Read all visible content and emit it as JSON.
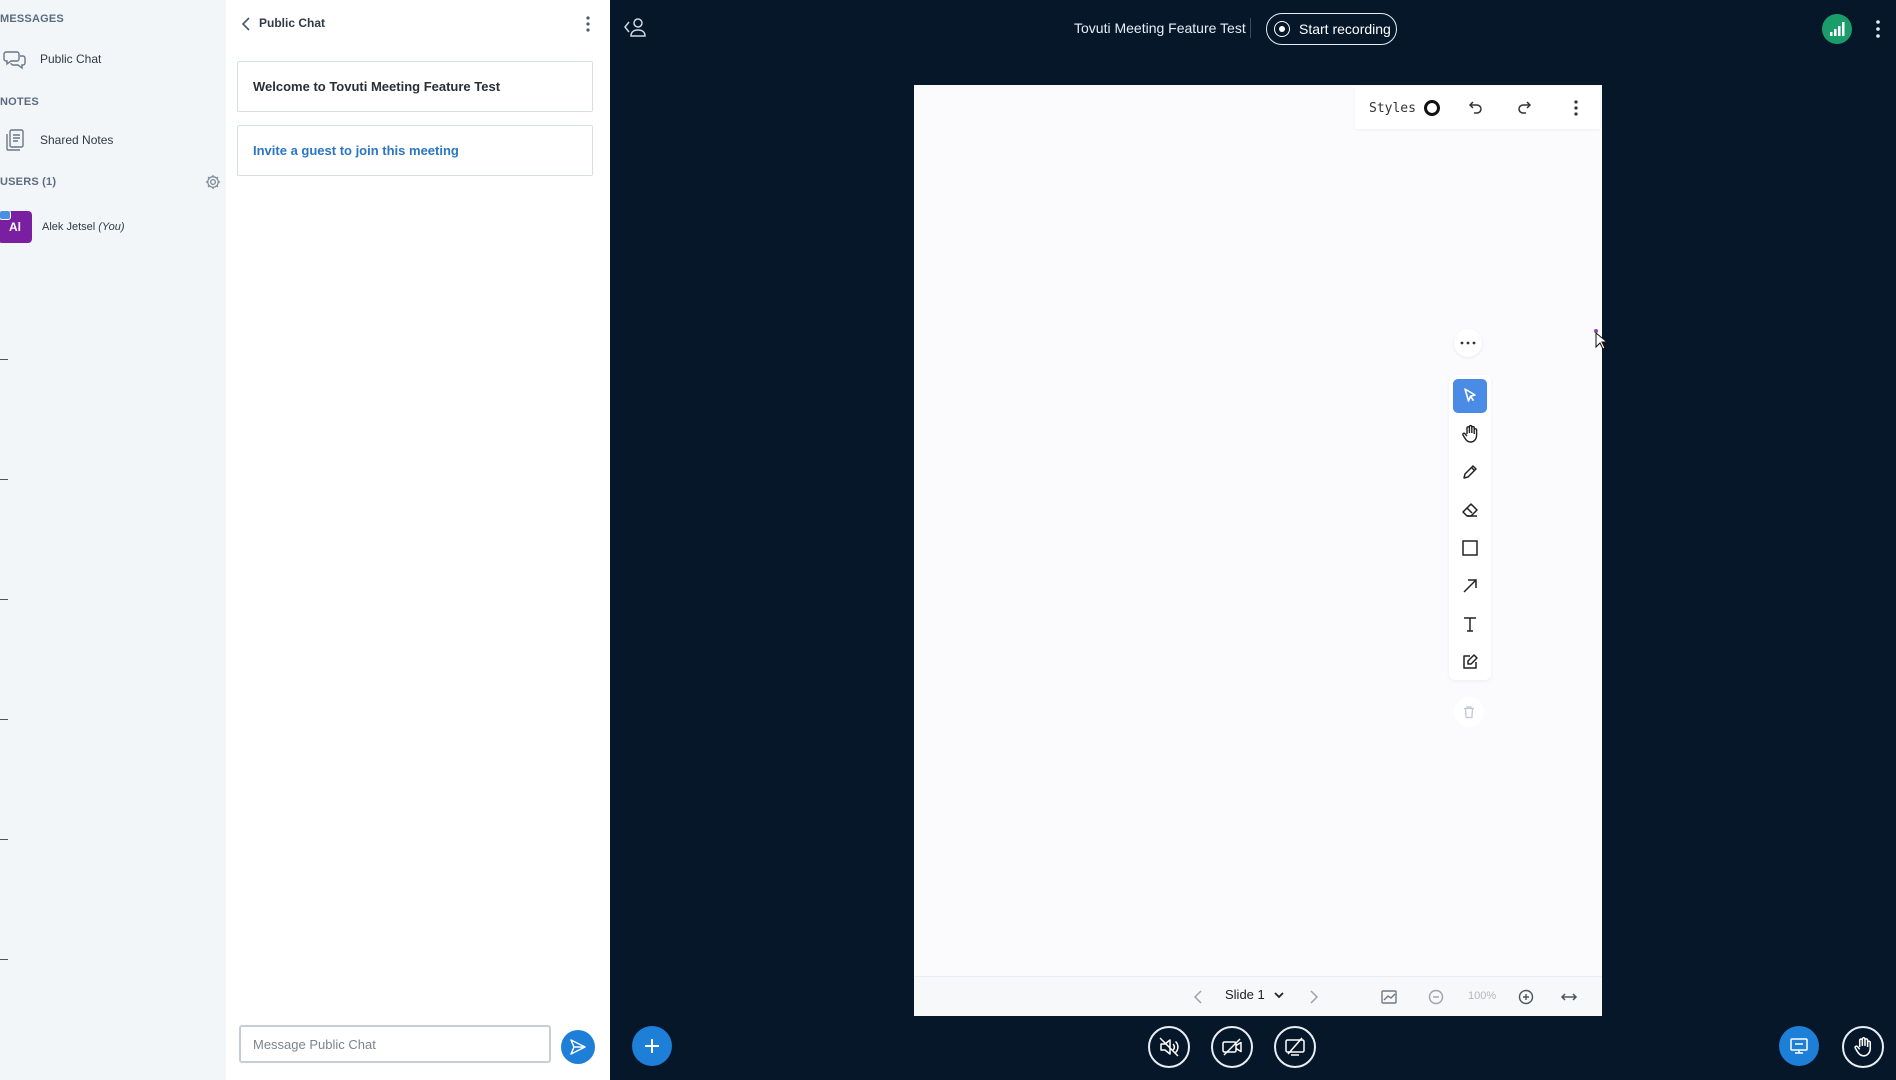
{
  "sidebar": {
    "messages_heading": "MESSAGES",
    "public_chat_label": "Public Chat",
    "notes_heading": "NOTES",
    "shared_notes_label": "Shared Notes",
    "users_heading": "USERS (1)",
    "users": [
      {
        "initials": "Al",
        "name": "Alek Jetsel",
        "you_label": "(You)",
        "avatar_color": "#7b1fa2"
      }
    ]
  },
  "chat": {
    "title": "Public Chat",
    "welcome_message": "Welcome to Tovuti Meeting Feature Test",
    "invite_link": "Invite a guest to join this meeting",
    "input_placeholder": "Message Public Chat"
  },
  "header": {
    "meeting_title": "Tovuti Meeting Feature Test",
    "record_label": "Start recording"
  },
  "whiteboard": {
    "styles_label": "Styles",
    "slide_label": "Slide 1",
    "zoom_label": "100%",
    "active_tool": "select",
    "tools": [
      "select",
      "pan",
      "pencil",
      "eraser",
      "rectangle",
      "arrow",
      "text",
      "note"
    ]
  },
  "colors": {
    "stage_background": "#06172a",
    "accent": "#1e7fd9",
    "active_tool": "#4a8be6",
    "connection": "#1b9c6b"
  }
}
